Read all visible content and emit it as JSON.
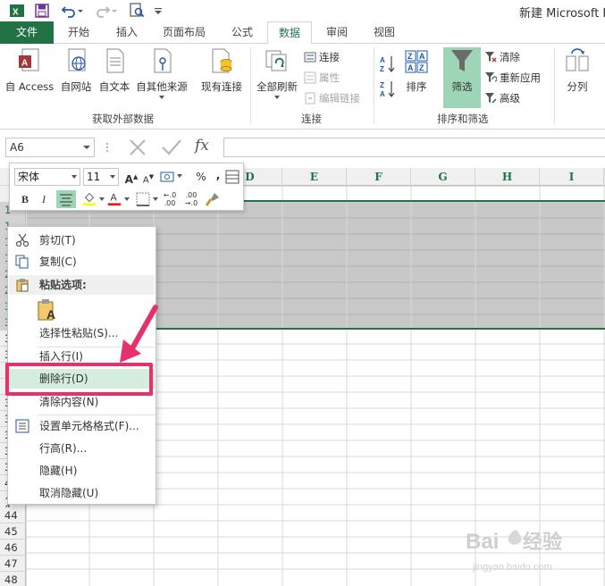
{
  "title_bar": {
    "title": "新建 Microsoft E"
  },
  "tabs": [
    "文件",
    "开始",
    "插入",
    "页面布局",
    "公式",
    "数据",
    "审阅",
    "视图"
  ],
  "active_tab": "数据",
  "ribbon": {
    "group_external": {
      "label": "获取外部数据",
      "buttons": [
        "自 Access",
        "自网站",
        "自文本",
        "自其他来源",
        "现有连接"
      ]
    },
    "group_connections": {
      "label": "连接",
      "big_button": "全部刷新",
      "small_buttons": [
        "连接",
        "属性",
        "编辑链接"
      ]
    },
    "group_sort": {
      "label": "排序和筛选",
      "sort_button": "排序",
      "filter_button": "筛选",
      "small_buttons": [
        "清除",
        "重新应用",
        "高级"
      ]
    },
    "group_tools": {
      "split_button": "分列"
    }
  },
  "formula_bar": {
    "name_box": "A6",
    "fx": "fx",
    "formula": ""
  },
  "columns": [
    "D",
    "E",
    "F",
    "G",
    "H",
    "I"
  ],
  "row_headers_top": [
    "1",
    "1",
    "1",
    "1",
    "2",
    "2",
    "3",
    "3"
  ],
  "row_headers_side": [
    "3",
    "3",
    "3",
    "3",
    "3",
    "3",
    "3",
    "3",
    "3",
    "4",
    "4",
    "4"
  ],
  "row_headers_bottom": [
    "44",
    "45",
    "46",
    "47",
    "48"
  ],
  "mini_toolbar": {
    "font": "宋体",
    "size": "11",
    "bold": "B",
    "italic": "I",
    "percent": "%",
    "comma": ","
  },
  "context_menu": {
    "items": [
      "剪切(T)",
      "复制(C)",
      "选择性粘贴(S)...",
      "插入行(I)",
      "删除行(D)",
      "清除内容(N)",
      "设置单元格格式(F)...",
      "行高(R)...",
      "隐藏(H)",
      "取消隐藏(U)"
    ],
    "paste_header": "粘贴选项:",
    "highlighted_item": "删除行(D)"
  },
  "colors": {
    "excel_green": "#217346",
    "selection_gray": "#c8c8c8",
    "highlight_green": "#d5eddc",
    "annotation_pink": "#e8306b"
  },
  "watermark": {
    "brand": "Bai",
    "text": "经验",
    "url": "jingyan.baidu.com"
  }
}
